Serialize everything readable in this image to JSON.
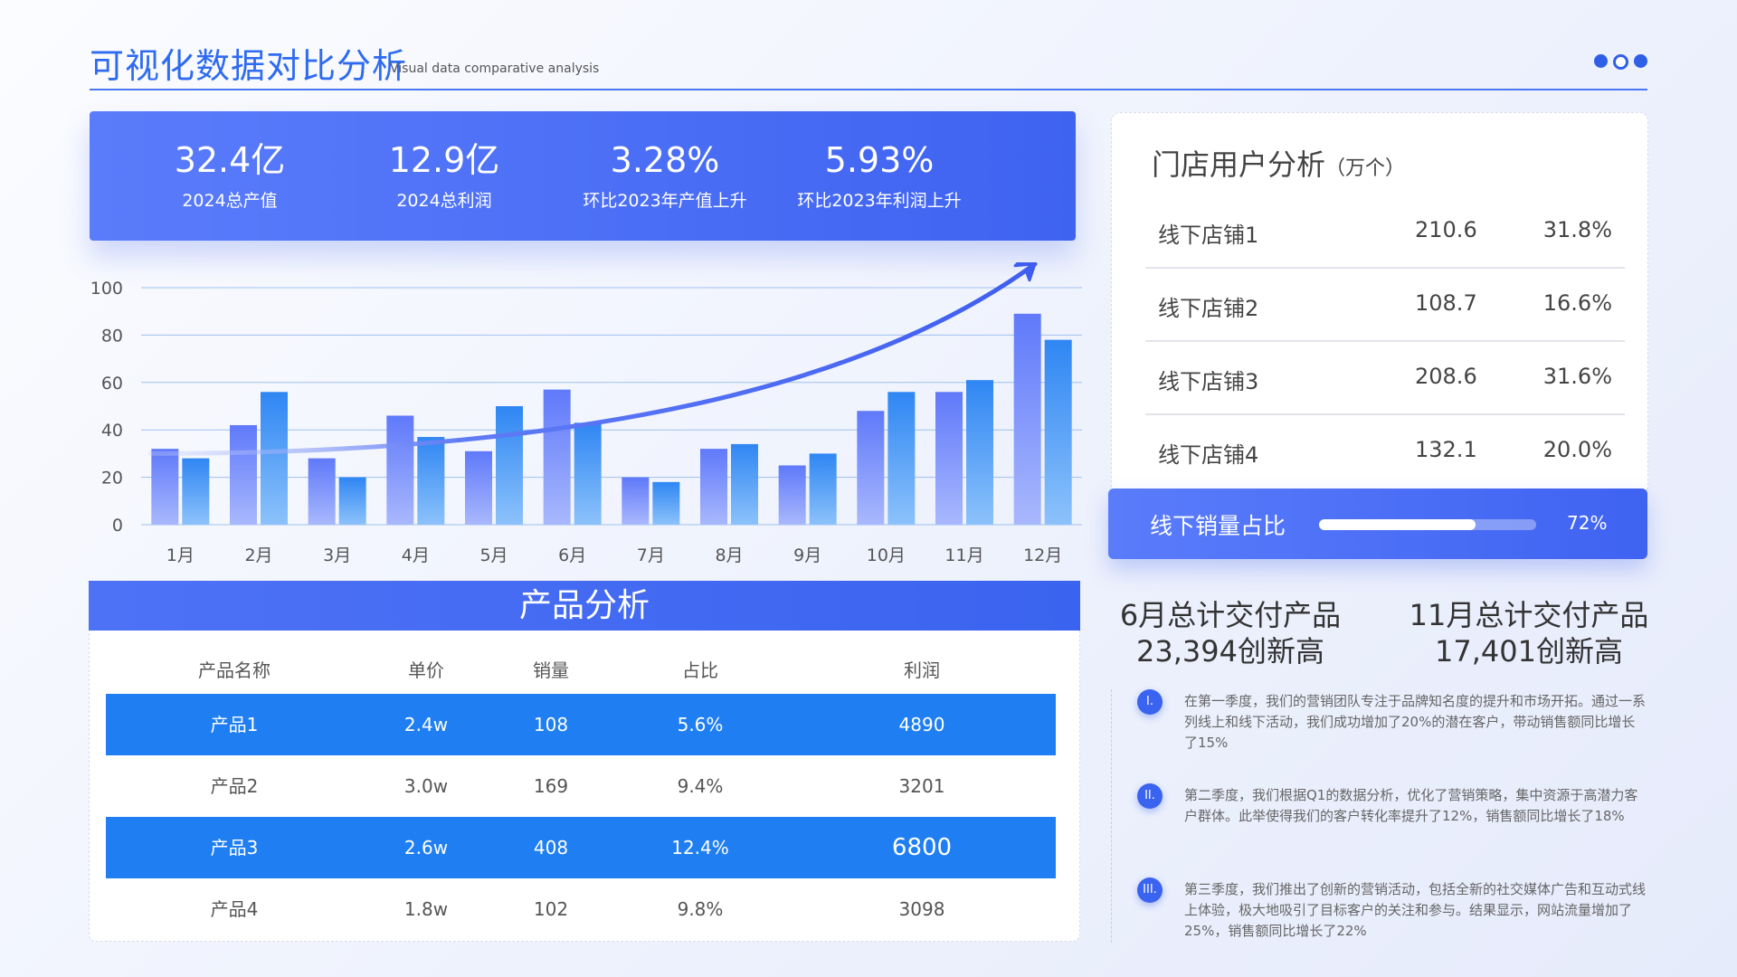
{
  "header": {
    "title": "可视化数据对比分析",
    "subtitle": "Visual data comparative analysis"
  },
  "kpis": [
    {
      "value": "32.4亿",
      "label": "2024总产值"
    },
    {
      "value": "12.9亿",
      "label": "2024总利润"
    },
    {
      "value": "3.28%",
      "label": "环比2023年产值上升"
    },
    {
      "value": "5.93%",
      "label": "环比2023年利润上升"
    }
  ],
  "chart_data": {
    "type": "bar",
    "categories": [
      "1月",
      "2月",
      "3月",
      "4月",
      "5月",
      "6月",
      "7月",
      "8月",
      "9月",
      "10月",
      "11月",
      "12月"
    ],
    "series": [
      {
        "values": [
          32,
          42,
          28,
          46,
          31,
          57,
          20,
          32,
          25,
          48,
          56,
          89
        ]
      },
      {
        "values": [
          28,
          56,
          20,
          37,
          50,
          43,
          18,
          34,
          30,
          56,
          61,
          78
        ]
      }
    ],
    "ylim": [
      0,
      100
    ],
    "yticks": [
      0,
      20,
      40,
      60,
      80,
      100
    ],
    "grid": true,
    "colors": {
      "series1": "#6a85fb",
      "series2": "#3b8ff4",
      "trend": "#3f5ef0"
    }
  },
  "products": {
    "title": "产品分析",
    "columns": [
      "产品名称",
      "单价",
      "销量",
      "占比",
      "利润"
    ],
    "rows": [
      {
        "name": "产品1",
        "price": "2.4w",
        "sales": "108",
        "share": "5.6%",
        "profit": "4890",
        "highlight": true
      },
      {
        "name": "产品2",
        "price": "3.0w",
        "sales": "169",
        "share": "9.4%",
        "profit": "3201",
        "highlight": false
      },
      {
        "name": "产品3",
        "price": "2.6w",
        "sales": "408",
        "share": "12.4%",
        "profit": "6800",
        "highlight": true
      },
      {
        "name": "产品4",
        "price": "1.8w",
        "sales": "102",
        "share": "9.8%",
        "profit": "3098",
        "highlight": false
      }
    ]
  },
  "store": {
    "title": "门店用户分析",
    "unit": "（万个）",
    "rows": [
      {
        "name": "线下店铺1",
        "value": "210.6",
        "pct": "31.8%"
      },
      {
        "name": "线下店铺2",
        "value": "108.7",
        "pct": "16.6%"
      },
      {
        "name": "线下店铺3",
        "value": "208.6",
        "pct": "31.6%"
      },
      {
        "name": "线下店铺4",
        "value": "132.1",
        "pct": "20.0%"
      }
    ]
  },
  "sales_share": {
    "label": "线下销量占比",
    "percent_text": "72%",
    "fraction": 0.72
  },
  "highlights": [
    {
      "line1": "6月总计交付产品",
      "line2": "23,394创新高"
    },
    {
      "line1": "11月总计交付产品",
      "line2": "17,401创新高"
    }
  ],
  "notes": [
    {
      "badge": "I.",
      "text": "在第一季度，我们的营销团队专注于品牌知名度的提升和市场开拓。通过一系列线上和线下活动，我们成功增加了20%的潜在客户，带动销售额同比增长了15%"
    },
    {
      "badge": "II.",
      "text": "第二季度，我们根据Q1的数据分析，优化了营销策略，集中资源于高潜力客户群体。此举使得我们的客户转化率提升了12%，销售额同比增长了18%"
    },
    {
      "badge": "III.",
      "text": "第三季度，我们推出了创新的营销活动，包括全新的社交媒体广告和互动式线上体验，极大地吸引了目标客户的关注和参与。结果显示，网站流量增加了25%，销售额同比增长了22%"
    }
  ]
}
